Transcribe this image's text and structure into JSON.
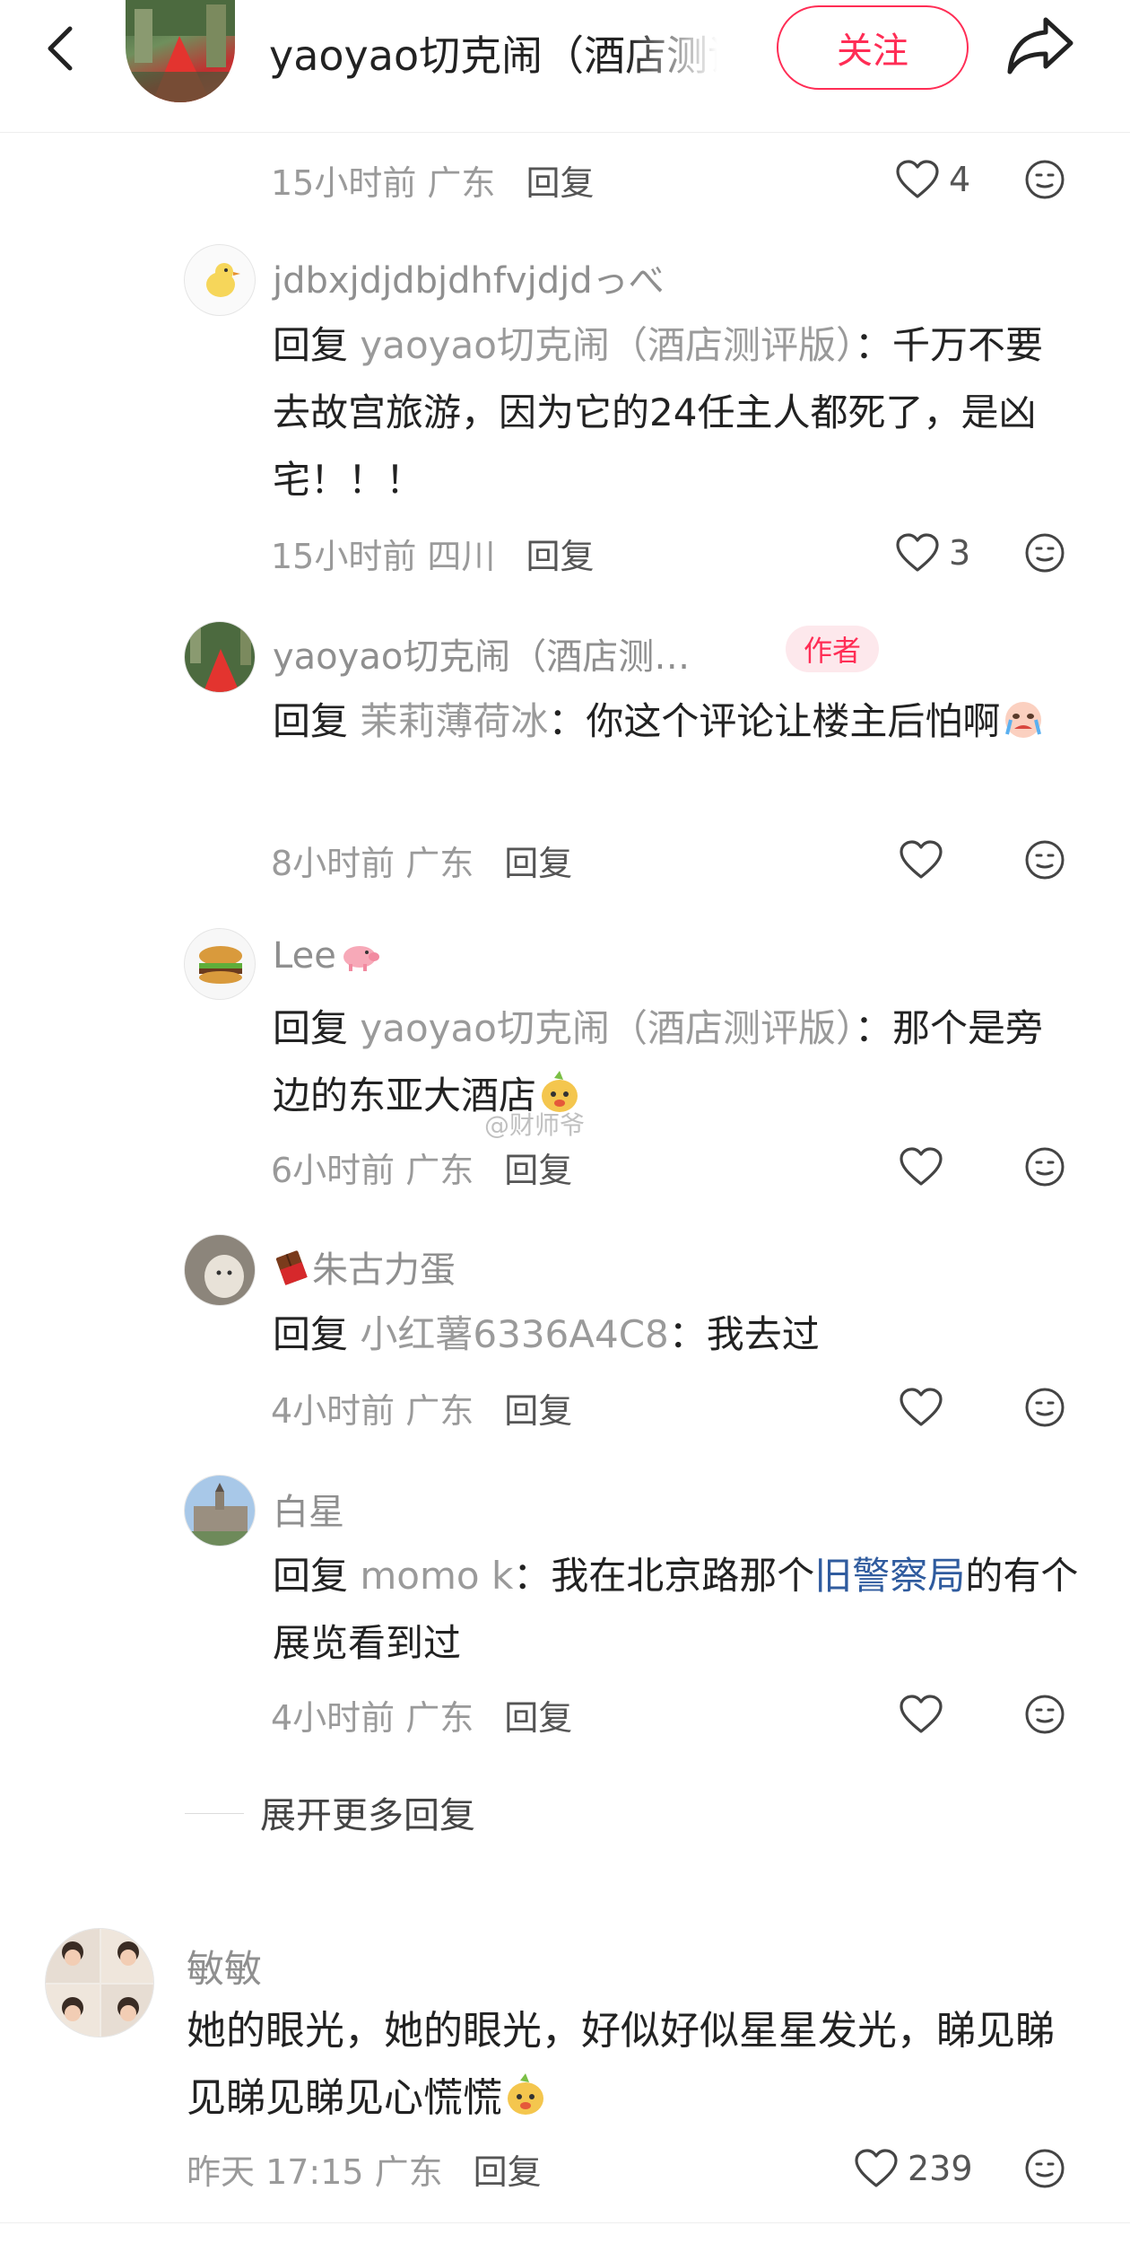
{
  "header": {
    "title": "yaoyao切克闹（酒店测评版）",
    "follow_label": "关注"
  },
  "watermark": "@财师爷",
  "top_meta": {
    "time": "15小时前 广东",
    "reply": "回复",
    "likes": "4"
  },
  "replies": [
    {
      "name": "jdbxjdjdbjdhfvjdjdっべ",
      "reply_prefix": "回复",
      "reply_target": "yaoyao切克闹（酒店测评版）",
      "text": "：千万不要去故宫旅游，因为它的24任主人都死了，是凶宅！！！",
      "time": "15小时前 四川",
      "reply": "回复",
      "likes": "3"
    },
    {
      "name": "yaoyao切克闹（酒店测…",
      "badge": "作者",
      "reply_prefix": "回复",
      "reply_target": "茉莉薄荷冰",
      "text": "：你这个评论让楼主后怕啊",
      "time": "8小时前 广东",
      "reply": "回复",
      "likes": ""
    },
    {
      "name": "Lee",
      "reply_prefix": "回复",
      "reply_target": "yaoyao切克闹（酒店测评版）",
      "text": "：那个是旁边的东亚大酒店",
      "time": "6小时前 广东",
      "reply": "回复",
      "likes": ""
    },
    {
      "name": "朱古力蛋",
      "reply_prefix": "回复",
      "reply_target": "小红薯6336A4C8",
      "text": "：我去过",
      "time": "4小时前 广东",
      "reply": "回复",
      "likes": ""
    },
    {
      "name": "白星",
      "reply_prefix": "回复",
      "reply_target": "momo k",
      "text": "：我在北京路那个",
      "link_text": "旧警察局",
      "text_after": "的有个展览看到过",
      "time": "4小时前 广东",
      "reply": "回复",
      "likes": ""
    }
  ],
  "expand_more": "展开更多回复",
  "main_comment": {
    "name": "敏敏",
    "text": "她的眼光，她的眼光，好似好似星星发光，睇见睇见睇见睇见心慌慌",
    "time": "昨天 17:15 广东",
    "reply": "回复",
    "likes": "239"
  },
  "colors": {
    "accent": "#ff2d55",
    "link": "#2f5b9e",
    "meta": "#9a9a9a"
  },
  "icons": [
    "back-arrow-icon",
    "share-icon",
    "heart-icon",
    "emoji-face-icon",
    "chocolate-icon",
    "pig-icon",
    "bird-emoji-icon",
    "crying-emoji-icon",
    "dog-emoji-icon"
  ]
}
